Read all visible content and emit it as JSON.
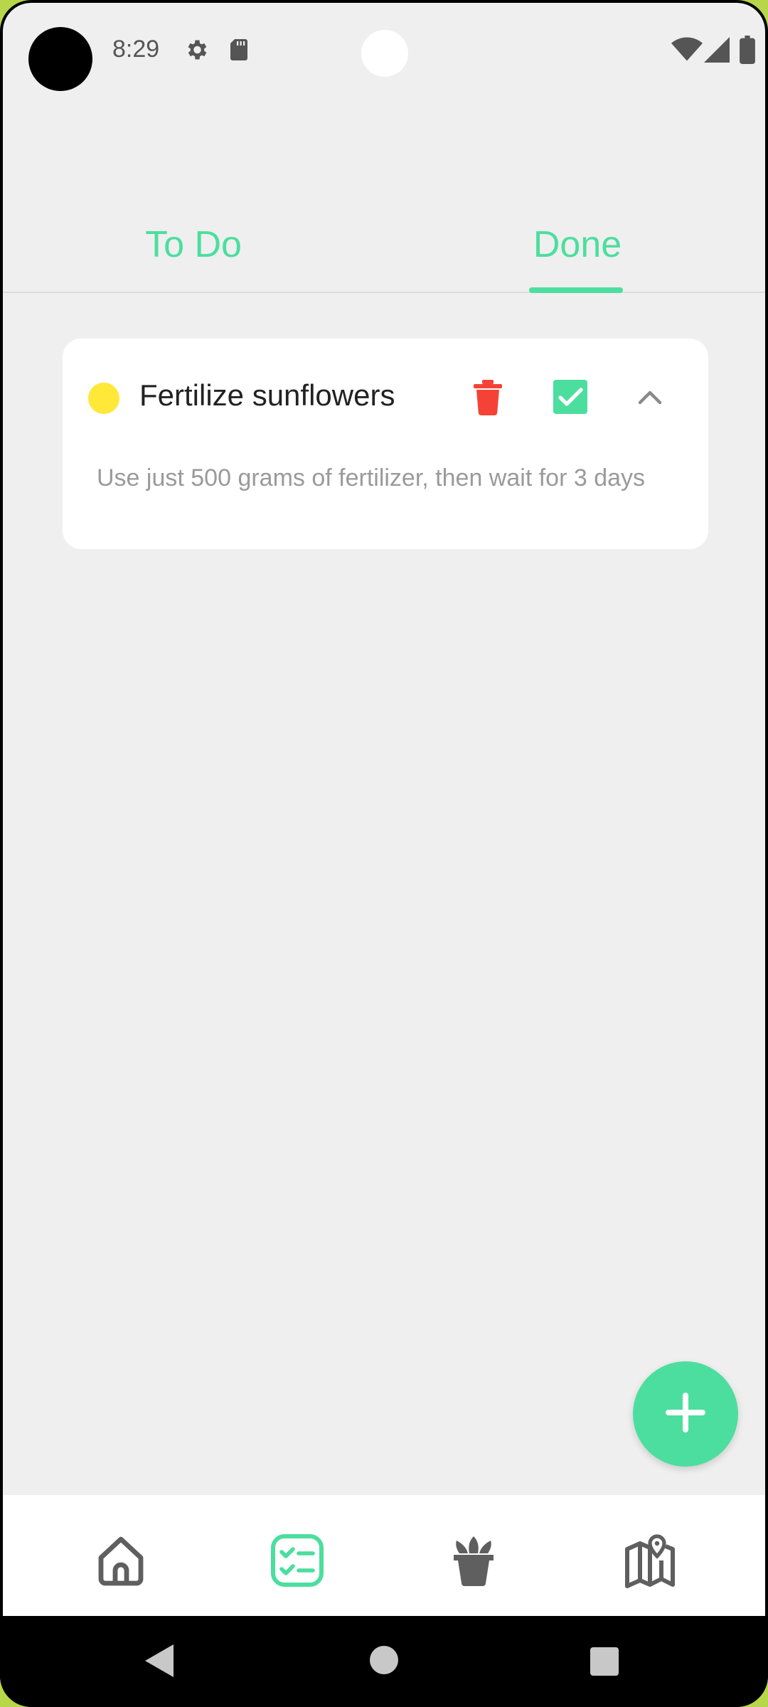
{
  "status_bar": {
    "time": "8:29",
    "left_icons": [
      "gear-icon",
      "sd-card-icon"
    ],
    "right_icons": [
      "wifi-icon",
      "cell-signal-icon",
      "battery-icon"
    ]
  },
  "tabs": [
    {
      "label": "To Do",
      "selected": false
    },
    {
      "label": "Done",
      "selected": true
    }
  ],
  "task": {
    "title": "Fertilize sunflowers",
    "description": "Use just 500 grams of fertilizer, then wait for 3 days",
    "priority_color": "#FFE838",
    "completed": true,
    "expanded": true,
    "actions": [
      "delete-icon",
      "checkbox-checked-icon",
      "chevron-up-icon"
    ]
  },
  "fab": {
    "icon": "plus-icon"
  },
  "bottom_nav": {
    "items": [
      {
        "icon": "home-icon",
        "selected": false
      },
      {
        "icon": "checklist-icon",
        "selected": true
      },
      {
        "icon": "plant-pot-icon",
        "selected": false
      },
      {
        "icon": "map-icon",
        "selected": false
      }
    ]
  },
  "system_nav": [
    "back-icon",
    "home-circle-icon",
    "recents-icon"
  ],
  "colors": {
    "accent": "#4CDE9E",
    "delete": "#F44336",
    "background": "#EFEFEF",
    "card": "#FFFFFF",
    "icon_gray": "#5F5F5F"
  }
}
